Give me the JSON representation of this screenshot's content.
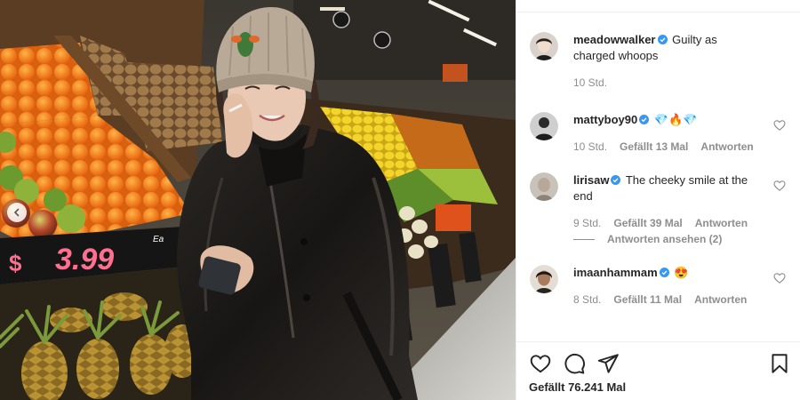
{
  "carousel": {
    "prev_icon": "chevron-left-icon"
  },
  "photo_text": {
    "price_sign": "$",
    "price": "3.99",
    "price_unit": "Ea"
  },
  "caption": {
    "username": "meadowwalker",
    "text": "Guilty as charged whoops",
    "time": "10 Std."
  },
  "comments": [
    {
      "username": "mattyboy90",
      "text": "💎🔥💎",
      "time": "10 Std.",
      "likes": "Gefällt 13 Mal",
      "reply": "Antworten"
    },
    {
      "username": "lirisaw",
      "text": "The cheeky smile at the end",
      "time": "9 Std.",
      "likes": "Gefällt 39 Mal",
      "reply": "Antworten",
      "view_replies": "Antworten ansehen (2)"
    },
    {
      "username": "imaanhammam",
      "text": "😍",
      "time": "8 Std.",
      "likes": "Gefällt 11 Mal",
      "reply": "Antworten"
    }
  ],
  "actions": {
    "likes_count": "Gefällt 76.241 Mal"
  },
  "colors": {
    "verified": "#3897f0",
    "muted": "#8e8e8e",
    "text": "#262626"
  }
}
